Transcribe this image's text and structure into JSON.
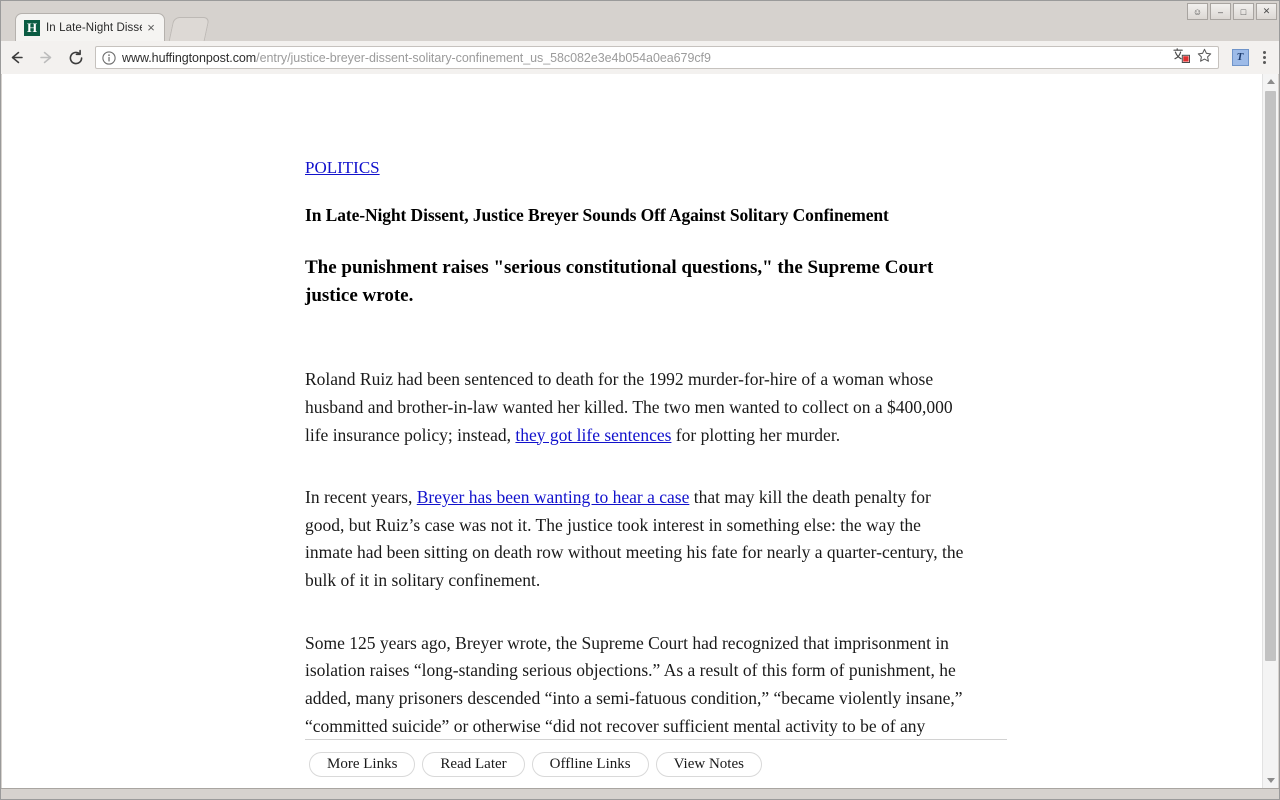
{
  "browser": {
    "tab": {
      "title": "In Late-Night Dissen",
      "favicon_letter": "H",
      "favicon_color": "#0b5c43",
      "close_label": "×"
    },
    "new_tab_label": "",
    "window_controls": {
      "profile": "☺",
      "minimize": "–",
      "maximize": "□",
      "close": "✕"
    },
    "omnibox": {
      "host": "www.huffingtonpost.com",
      "path": "/entry/justice-breyer-dissent-solitary-confinement_us_58c082e3e4b054a0ea679cf9",
      "security_icon": "info-circle-icon"
    },
    "extension_label": "T"
  },
  "article": {
    "kicker": "POLITICS",
    "headline": "In Late-Night Dissent, Justice Breyer Sounds Off Against Solitary Confinement",
    "deck": "The punishment raises \"serious constitutional questions,\" the Supreme Court justice wrote.",
    "paragraphs": [
      {
        "segments": [
          {
            "type": "text",
            "text": "Roland Ruiz had been sentenced to death for the 1992 murder-for-hire of a woman whose husband and brother-in-law wanted her killed. The two men wanted to collect on a $400,000 life insurance policy; instead, "
          },
          {
            "type": "link",
            "text": "they got life sentences"
          },
          {
            "type": "text",
            "text": " for plotting her murder."
          }
        ]
      },
      {
        "segments": [
          {
            "type": "text",
            "text": "In recent years, "
          },
          {
            "type": "link",
            "text": "Breyer has been wanting to hear a case"
          },
          {
            "type": "text",
            "text": " that may kill the death penalty for good, but Ruiz’s case was not it. The justice took interest in something else: the way the inmate had been sitting on death row without meeting his fate for nearly a quarter-century, the bulk of it in solitary confinement."
          }
        ]
      },
      {
        "segments": [
          {
            "type": "text",
            "text": "Some 125 years ago, Breyer wrote, the Supreme Court had recognized that imprisonment in isolation raises “long-standing serious objections.” As a result of this form of punishment, he added, many prisoners descended “into a semi-fatuous condition,” “became violently insane,” “committed suicide” or otherwise “did not recover sufficient mental activity to be of any subsequent service to the community.”"
          }
        ]
      }
    ],
    "link_color": "#1111cc"
  },
  "page_toolbar": {
    "buttons": [
      {
        "label": "More Links"
      },
      {
        "label": "Read Later"
      },
      {
        "label": "Offline Links"
      },
      {
        "label": "View Notes"
      }
    ]
  }
}
